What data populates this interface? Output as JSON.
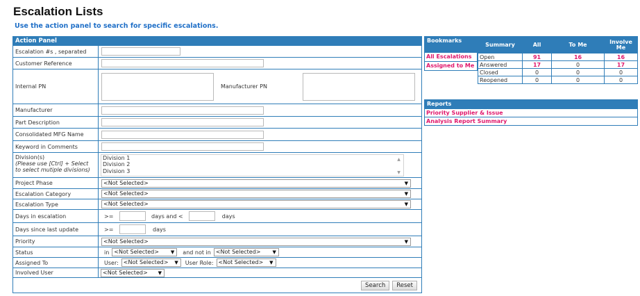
{
  "page": {
    "title": "Escalation Lists",
    "subtitle": "Use the action panel to search for specific escalations."
  },
  "action_panel": {
    "header": "Action Panel",
    "fields": {
      "escalation_numbers": "Escalation #s , separated",
      "customer_reference": "Customer Reference",
      "internal_pn": "Internal PN",
      "manufacturer_pn": "Manufacturer PN",
      "manufacturer": "Manufacturer",
      "part_description": "Part Description",
      "consolidated_mfg_name": "Consolidated MFG Name",
      "keyword_in_comments": "Keyword in Comments",
      "divisions_label": "Division(s)",
      "divisions_hint_1": "(Please use [Ctrl] + Select",
      "divisions_hint_2": "to select mutiple divisions)",
      "project_phase": "Project Phase",
      "escalation_category": "Escalation Category",
      "escalation_type": "Escalation Type",
      "days_in_escalation": "Days in escalation",
      "days_since_last_update": "Days since last update",
      "priority": "Priority",
      "status": "Status",
      "assigned_to": "Assigned To",
      "involved_user": "Involved User"
    },
    "divisions": [
      "Division 1",
      "Division 2",
      "Division 3"
    ],
    "not_selected": "<Not Selected>",
    "ge": ">=",
    "days_and_lt": "days and <",
    "days": "days",
    "status_in": "in",
    "and_not_in": "and not in",
    "user_label": "User:",
    "user_role_label": "User Role:",
    "search_button": "Search",
    "reset_button": "Reset"
  },
  "bookmarks": {
    "header": "Bookmarks",
    "items": [
      "All Escalations",
      "Assigned to Me"
    ]
  },
  "summary": {
    "headers": [
      "Summary",
      "All",
      "To Me",
      "Involve Me"
    ],
    "rows": [
      {
        "label": "Open",
        "all": "91",
        "to_me": "16",
        "involve_me": "16"
      },
      {
        "label": "Answered",
        "all": "17",
        "to_me": "0",
        "involve_me": "17"
      },
      {
        "label": "Closed",
        "all": "0",
        "to_me": "0",
        "involve_me": "0"
      },
      {
        "label": "Reopened",
        "all": "0",
        "to_me": "0",
        "involve_me": "0"
      }
    ]
  },
  "reports": {
    "header": "Reports",
    "items": [
      "Priority Supplier & Issue",
      "Analysis Report Summary"
    ]
  },
  "colors": {
    "panel_blue": "#2f7db8",
    "link_pink": "#e0186c",
    "subtitle_blue": "#1f6fc7"
  }
}
